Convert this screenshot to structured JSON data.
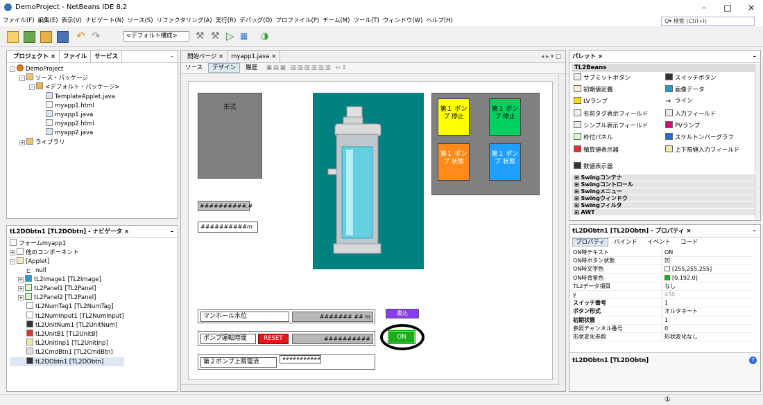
{
  "window": {
    "title": "DemoProject - NetBeans IDE 8.2",
    "minimize": "–",
    "maximize": "□",
    "close": "×"
  },
  "menubar": [
    "ファイル(F)",
    "編集(E)",
    "表示(V)",
    "ナビゲート(N)",
    "ソース(S)",
    "リファクタリング(A)",
    "実行(R)",
    "デバッグ(D)",
    "プロファイル(P)",
    "チーム(M)",
    "ツール(T)",
    "ウィンドウ(W)",
    "ヘルプ(H)"
  ],
  "search": {
    "placeholder": "Q▾ 検索 (Ctrl+I)"
  },
  "toolbar": {
    "config": "<デフォルト構成>"
  },
  "projects_panel": {
    "tabs": [
      "プロジェクト ×",
      "ファイル",
      "サービス"
    ],
    "minimize": "–",
    "tree": [
      "DemoProject",
      "ソース・パッケージ",
      "<デフォルト・パッケージ>",
      "TemplateApplet.java",
      "myapp1.html",
      "myapp1.java",
      "myapp2.html",
      "myapp2.java",
      "ライブラリ"
    ]
  },
  "navigator_panel": {
    "title": "tL2DObtn1 [TL2DObtn] - ナビゲータ ×",
    "minimize": "–",
    "tree": [
      "フォームmyapp1",
      "他のコンポーネント",
      "[Applet]",
      "null",
      "tL2Image1 [TL2Image]",
      "tL2Panel1 [TL2Panel]",
      "tL2Panel2 [TL2Panel]",
      "tL2NumTag1 [TL2NumTag]",
      "tL2NumInput1 [TL2NumInput]",
      "tL2UnitNum1 [TL2UnitNum]",
      "tL2UnitB1 [TL2UnitB]",
      "tL2UnitInp1 [TL2UnitInp]",
      "tL2CmdBtn1 [TL2CmdBtn]",
      "tL2DObtn1 [TL2DObtn]"
    ]
  },
  "editor": {
    "tabs": [
      "開始ページ ×",
      "myapp1.java ×"
    ],
    "subtabs": [
      "ソース",
      "デザイン",
      "履歴"
    ],
    "nav_arrows": "◂ ▸ ▾ □",
    "canvas": {
      "shape_box": "形式",
      "field1": "##########.#",
      "field2": "##########m",
      "buttons": [
        {
          "label": "第１ ポンプ 停止",
          "color": "#ffff00",
          "text_color": "#000000"
        },
        {
          "label": "第１ ポンプ 停止",
          "color": "#00d060",
          "text_color": "#000000"
        },
        {
          "label": "第１ ポンプ 状態",
          "color": "#ff8c1a",
          "text_color": "#ffffff"
        },
        {
          "label": "第１ ポンプ 状態",
          "color": "#1f9fff",
          "text_color": "#ffffff"
        }
      ],
      "row1_label": "マンホール水位",
      "row1_value": "####### ## m",
      "write_button": "書込",
      "row2_label": "ポンプ運転時間",
      "reset_button": "RESET",
      "row2_value": "##########",
      "row3_label": "第２ポンプ上限電流",
      "row3_value": "###########",
      "on_button": "ON"
    }
  },
  "palette": {
    "title": "パレット ×",
    "minimize": "–",
    "category": "TL2Beans",
    "items": [
      "サブミットボタン",
      "スイッチボタン",
      "初期値定義",
      "画像データ",
      "LVランプ",
      "ライン",
      "名前タグ表示フィールド",
      "入力フィールド",
      "シンプル表示フィールド",
      "PVランプ",
      "枠付パネル",
      "スケルトンバーグラフ",
      "積算値表示器",
      "上下限値入力フィールド",
      "数値表示器"
    ],
    "categories": [
      "Swingコンテナ",
      "Swingコントロール",
      "Swingメニュー",
      "Swingウィンドウ",
      "Swingフィルタ",
      "AWT"
    ]
  },
  "properties": {
    "title": "tL2DObtn1 [TL2DObtn] - プロパティ ×",
    "minimize": "–",
    "tabs": [
      "プロパティ",
      "バインド",
      "イベント",
      "コード"
    ],
    "rows": [
      {
        "k": "ON時テキスト",
        "v": "ON"
      },
      {
        "k": "ON時ボタン状態",
        "v": "凹"
      },
      {
        "k": "ON時文字色",
        "v": "[255,255,255]"
      },
      {
        "k": "ON時背景色",
        "v": "[0,192,0]"
      },
      {
        "k": "TL2データ項目",
        "v": "なし"
      },
      {
        "k": "y",
        "v": "450"
      },
      {
        "k": "スイッチ番号",
        "v": "1"
      },
      {
        "k": "ボタン形式",
        "v": "オルタネート"
      },
      {
        "k": "初期状態",
        "v": "1"
      },
      {
        "k": "参照チャンネル番号",
        "v": "0"
      },
      {
        "k": "形状変化参照",
        "v": "形状変化なし"
      }
    ],
    "footer": "tL2DObtn1 [TL2DObtn]"
  },
  "status": {
    "indicator": "①"
  }
}
